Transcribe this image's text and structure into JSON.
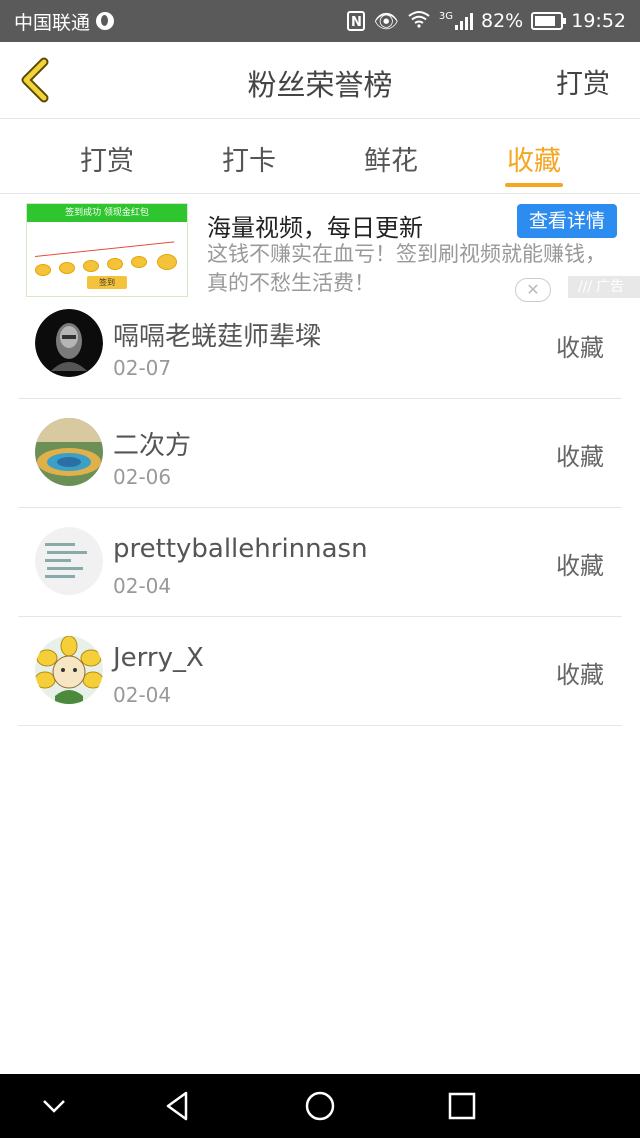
{
  "status_bar": {
    "carrier": "中国联通",
    "battery": "82%",
    "network": "3G",
    "time": "19:52"
  },
  "header": {
    "back_icon": "chevron-left-icon",
    "title": "粉丝荣誉榜",
    "action_label": "打赏"
  },
  "tabs": [
    {
      "label": "打赏",
      "active": false
    },
    {
      "label": "打卡",
      "active": false
    },
    {
      "label": "鲜花",
      "active": false
    },
    {
      "label": "收藏",
      "active": true
    }
  ],
  "ad": {
    "image_banner": "签到成功 领现金红包",
    "image_button": "签到",
    "title": "海量视频，每日更新",
    "description": "这钱不赚实在血亏！签到刷视频就能赚钱，真的不愁生活费！",
    "button_label": "查看详情",
    "tag_label": "广告"
  },
  "list": [
    {
      "name": "嗝嗝老蜣莛师辈墚",
      "date": "02-07",
      "action": "收藏"
    },
    {
      "name": "二次方",
      "date": "02-06",
      "action": "收藏"
    },
    {
      "name": "prettyballehrinnasn",
      "date": "02-04",
      "action": "收藏"
    },
    {
      "name": "Jerry_X",
      "date": "02-04",
      "action": "收藏"
    }
  ],
  "colors": {
    "accent": "#f5a623",
    "status_bar": "#5a5a5a",
    "ad_button": "#2d8cf0"
  }
}
